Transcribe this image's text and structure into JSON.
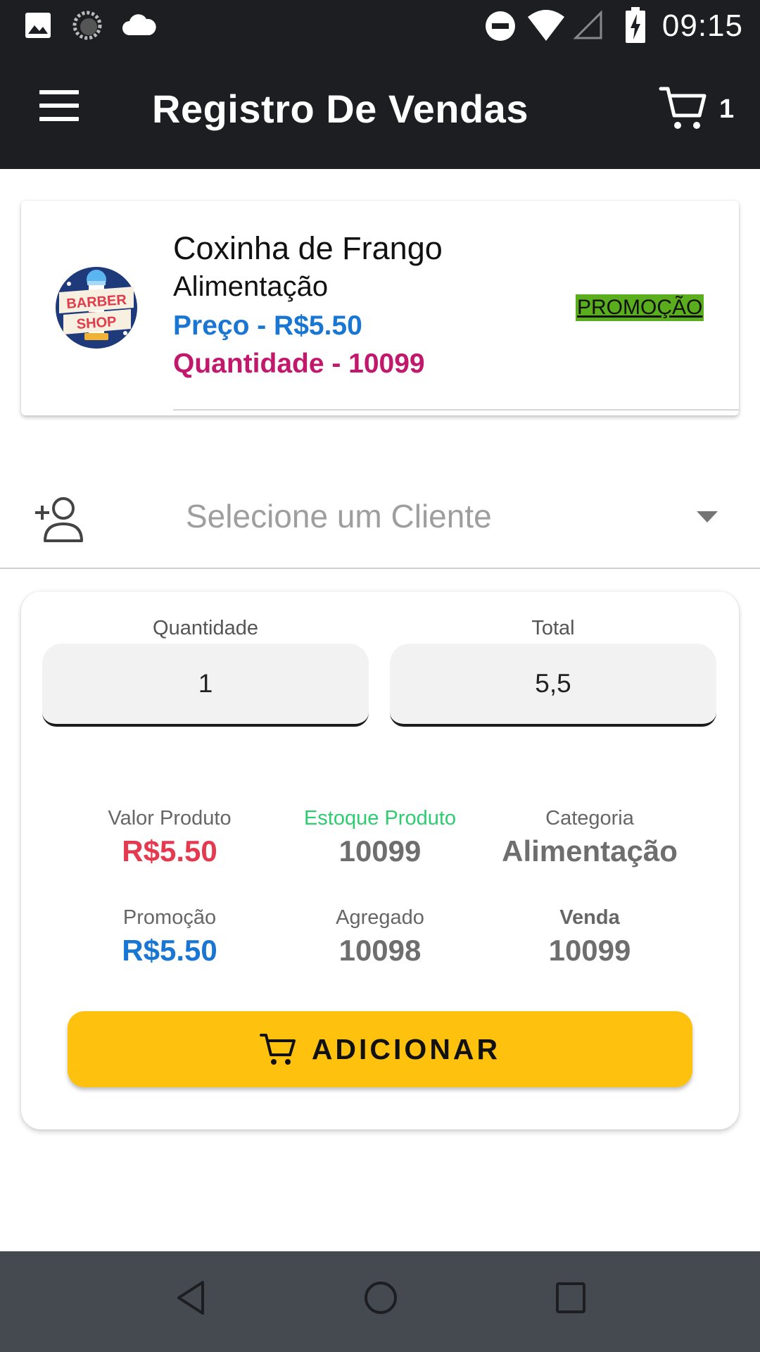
{
  "status_bar": {
    "time": "09:15",
    "left_icons": [
      "image-icon",
      "sync-icon",
      "cloud-icon"
    ],
    "right_icons": [
      "dnd-icon",
      "wifi-icon",
      "signal-icon",
      "battery-charging-icon"
    ]
  },
  "app_bar": {
    "title": "Registro De Vendas",
    "cart_count": "1"
  },
  "product": {
    "name": "Coxinha de Frango",
    "category": "Alimentação",
    "price": "Preço - R$5.50",
    "quantity": "Quantidade - 10099",
    "badge": "PROMOÇÃO",
    "logo_text": [
      "BARBER",
      "SHOP"
    ]
  },
  "client": {
    "placeholder": "Selecione um Cliente"
  },
  "form": {
    "quantity_label": "Quantidade",
    "quantity_value": "1",
    "total_label": "Total",
    "total_value": "5,5"
  },
  "stats": {
    "valor_label": "Valor Produto",
    "valor_value": "R$5.50",
    "estoque_label": "Estoque Produto",
    "estoque_value": "10099",
    "categoria_label": "Categoria",
    "categoria_value": "Alimentação",
    "promocao_label": "Promoção",
    "promocao_value": "R$5.50",
    "agregado_label": "Agregado",
    "agregado_value": "10098",
    "venda_label": "Venda",
    "venda_value": "10099"
  },
  "add_button": {
    "label": "ADICIONAR"
  },
  "colors": {
    "app_bar": "#1c1e22",
    "price_blue": "#1976d2",
    "quantity_magenta": "#c2186b",
    "promo_green": "#5aae1e",
    "valor_red": "#e53950",
    "estoque_green": "#2ecc71",
    "button_yellow": "#fdc10e",
    "nav_bar": "#454a50"
  }
}
